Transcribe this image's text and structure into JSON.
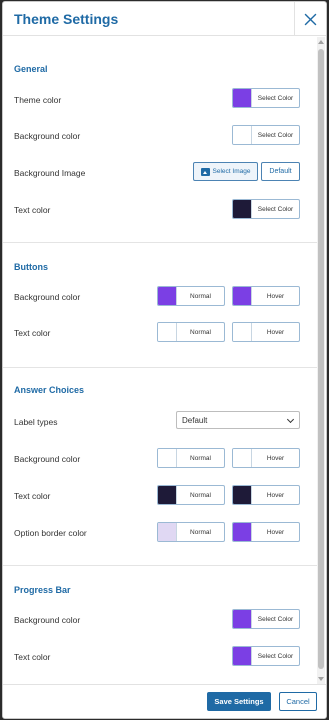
{
  "title": "Theme Settings",
  "sections": {
    "general": {
      "title": "General",
      "theme_color": {
        "label": "Theme color",
        "button": "Select Color",
        "color": "#7b3fe4"
      },
      "background_color": {
        "label": "Background color",
        "button": "Select Color",
        "color": "#ffffff"
      },
      "background_image": {
        "label": "Background Image",
        "select_image": "Select Image",
        "default": "Default"
      },
      "text_color": {
        "label": "Text color",
        "button": "Select Color",
        "color": "#1e1a38"
      }
    },
    "buttons": {
      "title": "Buttons",
      "background_color": {
        "label": "Background color",
        "normal": "Normal",
        "hover": "Hover",
        "normal_color": "#7b3fe4",
        "hover_color": "#7b3fe4"
      },
      "text_color": {
        "label": "Text color",
        "normal": "Normal",
        "hover": "Hover",
        "normal_color": "#ffffff",
        "hover_color": "#ffffff"
      }
    },
    "answer_choices": {
      "title": "Answer Choices",
      "label_types": {
        "label": "Label types",
        "value": "Default"
      },
      "background_color": {
        "label": "Background color",
        "normal": "Normal",
        "hover": "Hover",
        "normal_color": "#ffffff",
        "hover_color": "#ffffff"
      },
      "text_color": {
        "label": "Text color",
        "normal": "Normal",
        "hover": "Hover",
        "normal_color": "#1e1a38",
        "hover_color": "#1e1a38"
      },
      "option_border_color": {
        "label": "Option border color",
        "normal": "Normal",
        "hover": "Hover",
        "normal_color": "#e0d8f3",
        "hover_color": "#7b3fe4"
      }
    },
    "progress_bar": {
      "title": "Progress Bar",
      "background_color": {
        "label": "Background color",
        "button": "Select Color",
        "color": "#7b3fe4"
      },
      "text_color": {
        "label": "Text color",
        "button": "Select Color",
        "color": "#7b3fe4"
      }
    }
  },
  "footer": {
    "save": "Save Settings",
    "cancel": "Cancel"
  }
}
